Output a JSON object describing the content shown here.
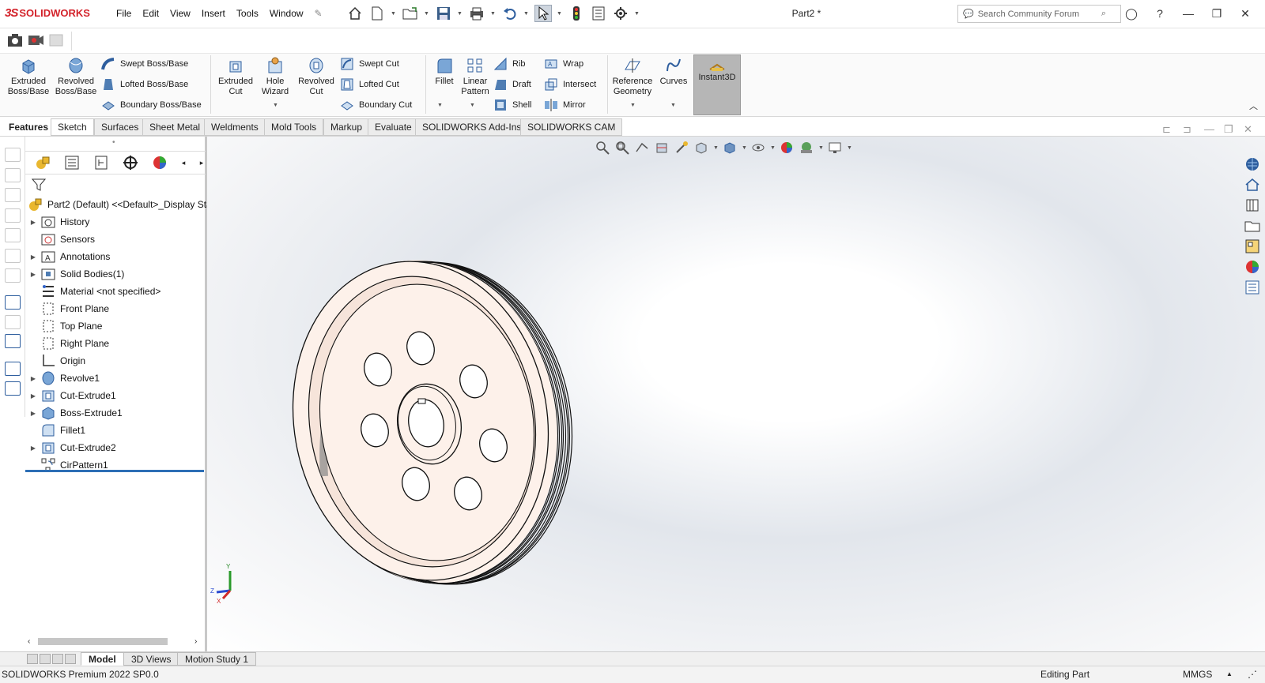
{
  "app": {
    "brand": "SOLIDWORKS",
    "doc_title": "Part2 *"
  },
  "menu": [
    "File",
    "Edit",
    "View",
    "Insert",
    "Tools",
    "Window"
  ],
  "search": {
    "placeholder": "Search Community Forum"
  },
  "ribbon": {
    "extruded_boss": "Extruded Boss/Base",
    "revolved_boss": "Revolved Boss/Base",
    "swept_boss": "Swept Boss/Base",
    "lofted_boss": "Lofted Boss/Base",
    "boundary_boss": "Boundary Boss/Base",
    "extruded_cut": "Extruded Cut",
    "hole_wizard": "Hole Wizard",
    "revolved_cut": "Revolved Cut",
    "swept_cut": "Swept Cut",
    "lofted_cut": "Lofted Cut",
    "boundary_cut": "Boundary Cut",
    "fillet": "Fillet",
    "linear_pattern": "Linear Pattern",
    "rib": "Rib",
    "draft": "Draft",
    "shell": "Shell",
    "wrap": "Wrap",
    "intersect": "Intersect",
    "mirror": "Mirror",
    "reference_geometry": "Reference Geometry",
    "curves": "Curves",
    "instant3d": "Instant3D"
  },
  "command_tabs": [
    "Features",
    "Sketch",
    "Surfaces",
    "Sheet Metal",
    "Weldments",
    "Mold Tools",
    "Markup",
    "Evaluate",
    "SOLIDWORKS Add-Ins",
    "SOLIDWORKS CAM"
  ],
  "tree": {
    "root": "Part2 (Default) <<Default>_Display Sta",
    "items": [
      "History",
      "Sensors",
      "Annotations",
      "Solid Bodies(1)",
      "Material <not specified>",
      "Front Plane",
      "Top Plane",
      "Right Plane",
      "Origin",
      "Revolve1",
      "Cut-Extrude1",
      "Boss-Extrude1",
      "Fillet1",
      "Cut-Extrude2",
      "CirPattern1"
    ]
  },
  "triad": {
    "y": "Y",
    "z": "Z",
    "x": "X"
  },
  "bottom_tabs": [
    "Model",
    "3D Views",
    "Motion Study 1"
  ],
  "status": {
    "product": "SOLIDWORKS Premium 2022 SP0.0",
    "mode": "Editing Part",
    "units": "MMGS"
  },
  "colors": {
    "brand_red": "#d3222a",
    "part_face": "#fdf1ea",
    "rollback_bar": "#2d6fb5",
    "instant3d_active": "#b6b6b6"
  }
}
